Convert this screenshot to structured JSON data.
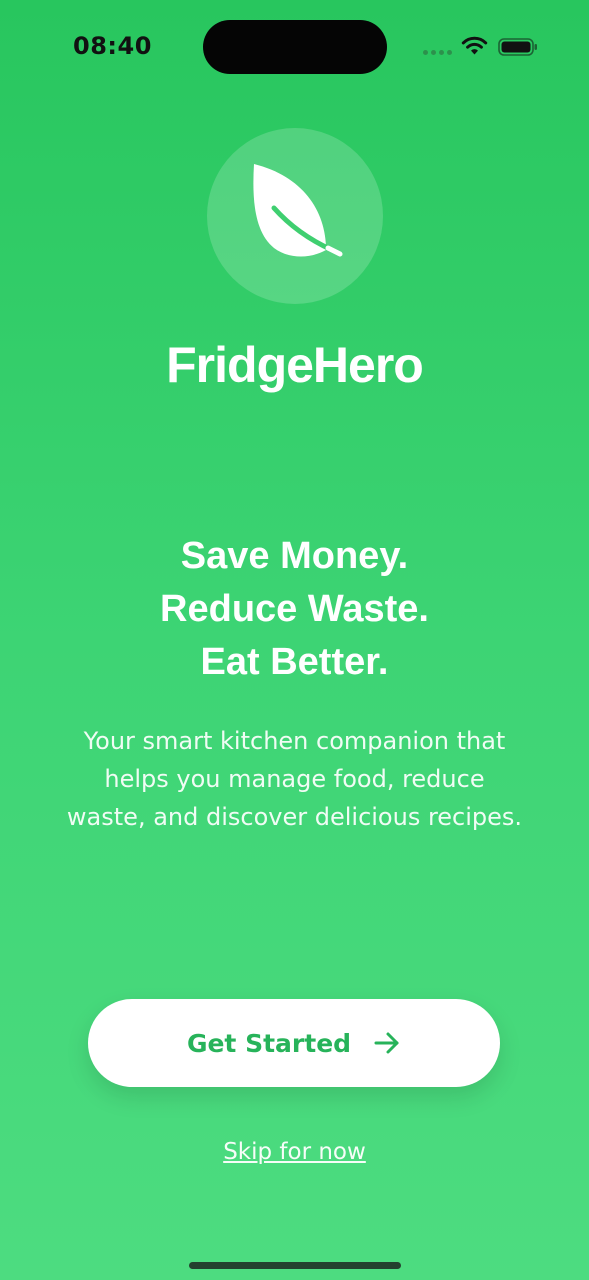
{
  "status_bar": {
    "time": "08:40"
  },
  "app": {
    "name": "FridgeHero",
    "logo_icon": "leaf-icon"
  },
  "headline": {
    "line1": "Save Money.",
    "line2": "Reduce Waste.",
    "line3": "Eat Better."
  },
  "description": "Your smart kitchen companion that helps you manage food, reduce waste, and discover delicious recipes.",
  "actions": {
    "primary_label": "Get Started",
    "primary_icon": "arrow-right-icon",
    "secondary_label": "Skip for now"
  },
  "colors": {
    "background_top": "#28c65e",
    "background_bottom": "#4ddc80",
    "button_text": "#27b35a"
  }
}
